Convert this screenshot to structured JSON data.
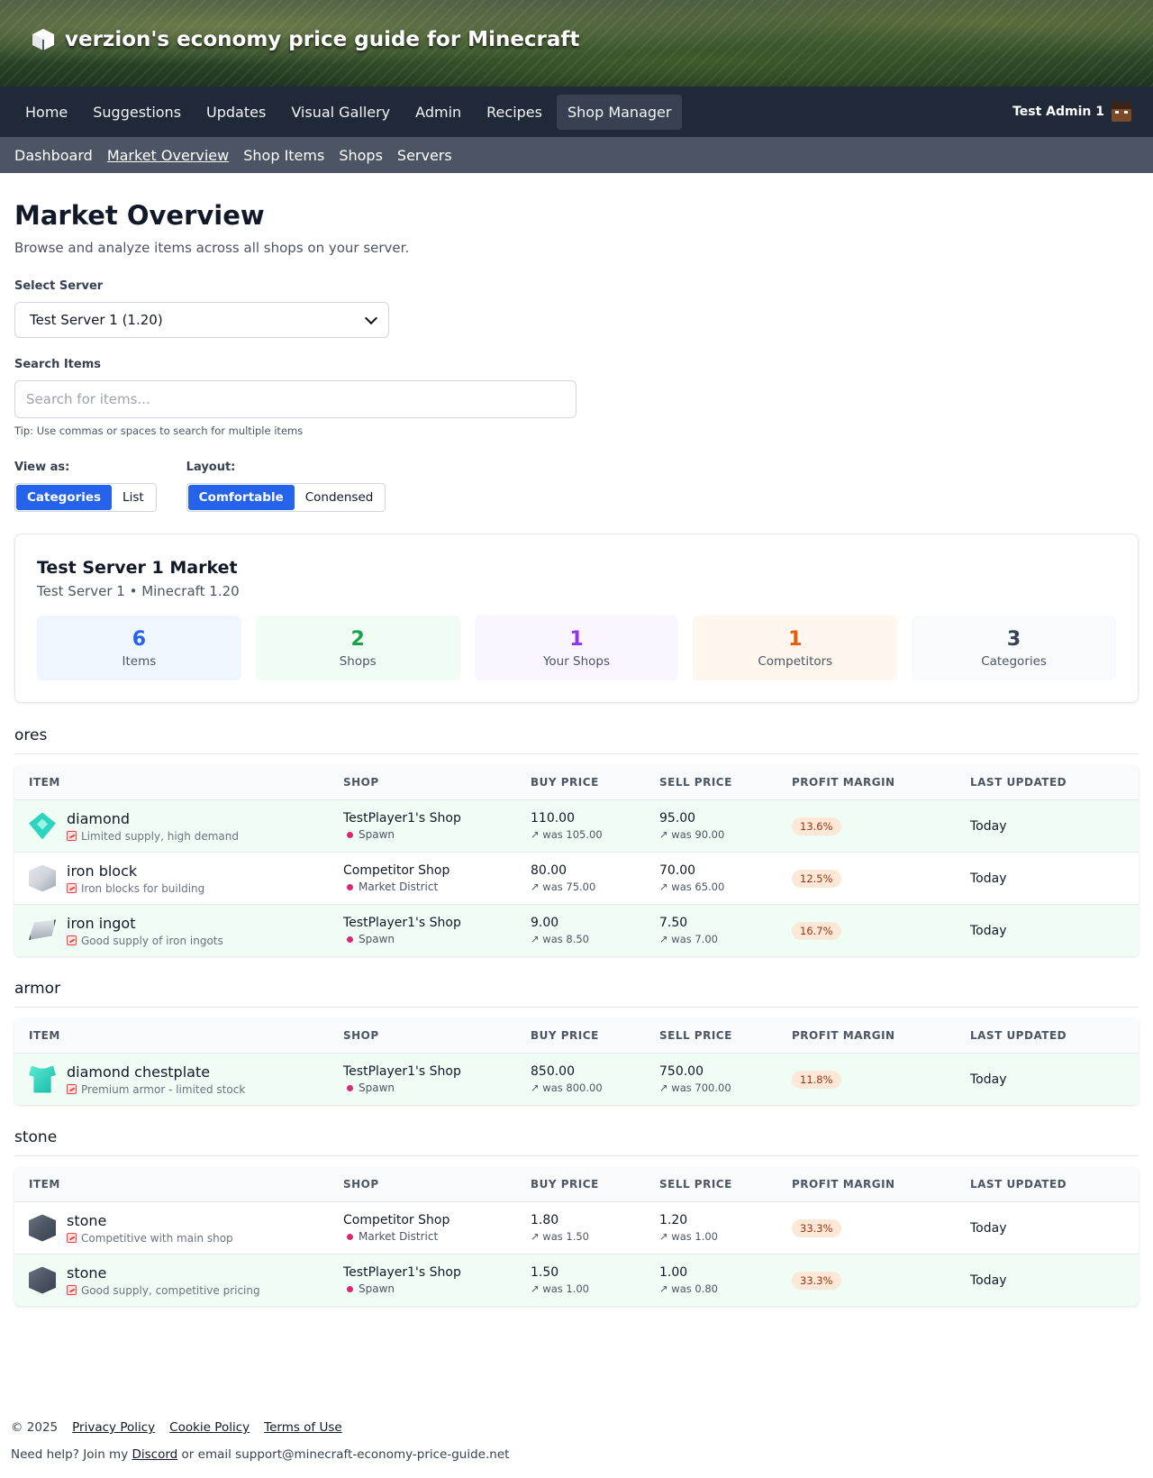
{
  "header": {
    "title": "verzion's economy price guide for Minecraft",
    "icon": "cube-icon"
  },
  "main_nav": {
    "items": [
      {
        "label": "Home"
      },
      {
        "label": "Suggestions"
      },
      {
        "label": "Updates"
      },
      {
        "label": "Visual Gallery"
      },
      {
        "label": "Admin"
      },
      {
        "label": "Recipes"
      },
      {
        "label": "Shop Manager",
        "active": true
      }
    ],
    "user": "Test Admin 1"
  },
  "sub_nav": {
    "items": [
      {
        "label": "Dashboard"
      },
      {
        "label": "Market Overview",
        "active": true
      },
      {
        "label": "Shop Items"
      },
      {
        "label": "Shops"
      },
      {
        "label": "Servers"
      }
    ]
  },
  "page": {
    "title": "Market Overview",
    "description": "Browse and analyze items across all shops on your server."
  },
  "server_select": {
    "label": "Select Server",
    "value": "Test Server 1 (1.20)"
  },
  "search": {
    "label": "Search Items",
    "placeholder": "Search for items...",
    "tip": "Tip: Use commas or spaces to search for multiple items"
  },
  "view_as": {
    "label": "View as:",
    "options": [
      "Categories",
      "List"
    ],
    "selected": "Categories"
  },
  "layout": {
    "label": "Layout:",
    "options": [
      "Comfortable",
      "Condensed"
    ],
    "selected": "Comfortable"
  },
  "market": {
    "title": "Test Server 1 Market",
    "subtitle": "Test Server 1 • Minecraft 1.20",
    "stats": [
      {
        "value": "6",
        "label": "Items",
        "color": "#2563eb",
        "bg": "#eff6ff"
      },
      {
        "value": "2",
        "label": "Shops",
        "color": "#16a34a",
        "bg": "#f0fdf4"
      },
      {
        "value": "1",
        "label": "Your Shops",
        "color": "#9333ea",
        "bg": "#faf5ff"
      },
      {
        "value": "1",
        "label": "Competitors",
        "color": "#ea580c",
        "bg": "#fff7ed"
      },
      {
        "value": "3",
        "label": "Categories",
        "color": "#374151",
        "bg": "#f9fafb"
      }
    ]
  },
  "table_headers": {
    "item": "ITEM",
    "shop": "SHOP",
    "buy": "BUY PRICE",
    "sell": "SELL PRICE",
    "margin": "PROFIT MARGIN",
    "updated": "LAST UPDATED"
  },
  "categories": [
    {
      "name": "ores",
      "rows": [
        {
          "icon": "diamond-icon",
          "name": "diamond",
          "note": "Limited supply, high demand",
          "shop": "TestPlayer1's Shop",
          "location": "Spawn",
          "buy": "110.00",
          "buy_was": "↗ was 105.00",
          "sell": "95.00",
          "sell_was": "↗ was 90.00",
          "margin": "13.6%",
          "updated": "Today",
          "highlight": true
        },
        {
          "icon": "iron-block-icon",
          "name": "iron block",
          "note": "Iron blocks for building",
          "shop": "Competitor Shop",
          "location": "Market District",
          "buy": "80.00",
          "buy_was": "↗ was 75.00",
          "sell": "70.00",
          "sell_was": "↗ was 65.00",
          "margin": "12.5%",
          "updated": "Today",
          "highlight": false
        },
        {
          "icon": "iron-ingot-icon",
          "name": "iron ingot",
          "note": "Good supply of iron ingots",
          "shop": "TestPlayer1's Shop",
          "location": "Spawn",
          "buy": "9.00",
          "buy_was": "↗ was 8.50",
          "sell": "7.50",
          "sell_was": "↗ was 7.00",
          "margin": "16.7%",
          "updated": "Today",
          "highlight": true
        }
      ]
    },
    {
      "name": "armor",
      "rows": [
        {
          "icon": "diamond-chestplate-icon",
          "name": "diamond chestplate",
          "note": "Premium armor - limited stock",
          "shop": "TestPlayer1's Shop",
          "location": "Spawn",
          "buy": "850.00",
          "buy_was": "↗ was 800.00",
          "sell": "750.00",
          "sell_was": "↗ was 700.00",
          "margin": "11.8%",
          "updated": "Today",
          "highlight": true
        }
      ]
    },
    {
      "name": "stone",
      "rows": [
        {
          "icon": "stone-icon",
          "name": "stone",
          "note": "Competitive with main shop",
          "shop": "Competitor Shop",
          "location": "Market District",
          "buy": "1.80",
          "buy_was": "↗ was 1.50",
          "sell": "1.20",
          "sell_was": "↗ was 1.00",
          "margin": "33.3%",
          "updated": "Today",
          "highlight": false
        },
        {
          "icon": "stone-icon",
          "name": "stone",
          "note": "Good supply, competitive pricing",
          "shop": "TestPlayer1's Shop",
          "location": "Spawn",
          "buy": "1.50",
          "buy_was": "↗ was 1.00",
          "sell": "1.00",
          "sell_was": "↗ was 0.80",
          "margin": "33.3%",
          "updated": "Today",
          "highlight": true
        }
      ]
    }
  ],
  "footer": {
    "copyright": "© 2025",
    "links": [
      "Privacy Policy",
      "Cookie Policy",
      "Terms of Use"
    ],
    "help_prefix": "Need help? Join my",
    "discord": "Discord",
    "help_suffix": "or email support@minecraft-economy-price-guide.net"
  }
}
